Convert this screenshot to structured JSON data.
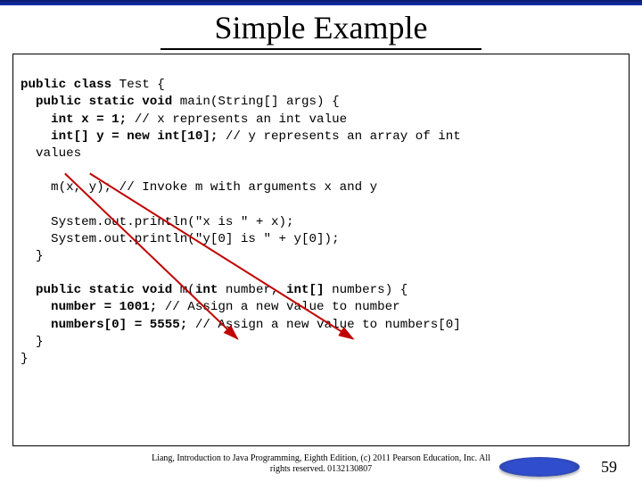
{
  "title": "Simple Example",
  "code": {
    "l01a": "public class",
    "l01b": " Test {",
    "l02a": "  public static void",
    "l02b": " main(String[] args) {",
    "l03a": "    int x = 1;",
    "l03b": " // x represents an int value",
    "l04a": "    int[] y = new int[10];",
    "l04b": " // y represents an array of int",
    "l05": "  values",
    "l06": "",
    "l07": "    m(x, y); // Invoke m with arguments x and y",
    "l08": "",
    "l09": "    System.out.println(\"x is \" + x);",
    "l10": "    System.out.println(\"y[0] is \" + y[0]);",
    "l11": "  }",
    "l12": "",
    "l13a": "  public static void",
    "l13b": " m(",
    "l13c": "int",
    "l13d": " number, ",
    "l13e": "int[]",
    "l13f": " numbers) {",
    "l14a": "    number = 1001;",
    "l14b": " // Assign a new value to number",
    "l15a": "    numbers[0] = 5555;",
    "l15b": " // Assign a new value to numbers[0]",
    "l16": "  }",
    "l17": "}"
  },
  "footer": {
    "copyright_line1": "Liang, Introduction to Java Programming, Eighth Edition, (c) 2011 Pearson Education, Inc. All",
    "copyright_line2": "rights reserved. 0132130807",
    "page": "59"
  }
}
